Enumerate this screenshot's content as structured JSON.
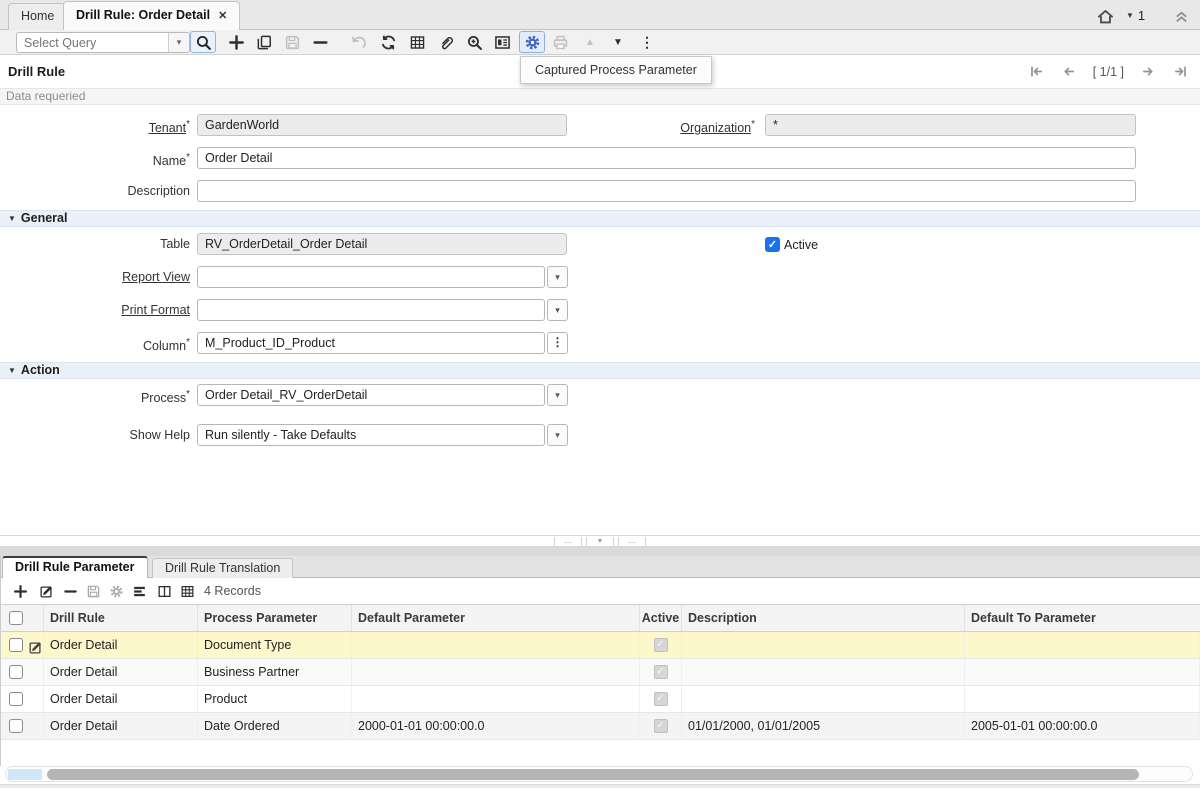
{
  "window": {
    "tabs": [
      {
        "label": "Home"
      },
      {
        "label": "Drill Rule: Order Detail"
      }
    ],
    "session_count": "1"
  },
  "icons": {
    "close": "✕",
    "chevron_down": "▾",
    "section_caret": "▼",
    "up_triangle": "▲",
    "down_triangle": "▼",
    "overflow": "⋮",
    "check": "✓",
    "ellipsis": "…"
  },
  "toolbar": {
    "select_query_placeholder": "Select Query",
    "tooltip": "Captured Process Parameter"
  },
  "header": {
    "title": "Drill Rule",
    "status": "Data requeried",
    "page_indicator": "[ 1/1 ]"
  },
  "form": {
    "required_marker": "*",
    "tenant": {
      "label": "Tenant",
      "value": "GardenWorld"
    },
    "organization": {
      "label": "Organization",
      "value": "*"
    },
    "name": {
      "label": "Name",
      "value": "Order Detail"
    },
    "description": {
      "label": "Description",
      "value": ""
    },
    "general_section": "General",
    "table": {
      "label": "Table",
      "value": "RV_OrderDetail_Order Detail"
    },
    "active": {
      "label": "Active",
      "checked": true
    },
    "report_view": {
      "label": "Report View",
      "value": ""
    },
    "print_format": {
      "label": "Print Format",
      "value": ""
    },
    "column": {
      "label": "Column",
      "value": "M_Product_ID_Product"
    },
    "action_section": "Action",
    "process": {
      "label": "Process",
      "value": "Order Detail_RV_OrderDetail"
    },
    "show_help": {
      "label": "Show Help",
      "value": "Run silently - Take Defaults"
    }
  },
  "detail": {
    "tabs": [
      {
        "label": "Drill Rule Parameter"
      },
      {
        "label": "Drill Rule Translation"
      }
    ],
    "records_label": "4 Records",
    "grid": {
      "columns": [
        "Drill Rule",
        "Process Parameter",
        "Default Parameter",
        "Active",
        "Description",
        "Default To Parameter"
      ],
      "rows": [
        {
          "drill_rule": "Order Detail",
          "process_parameter": "Document Type",
          "default_parameter": "",
          "active": true,
          "description": "",
          "default_to_parameter": ""
        },
        {
          "drill_rule": "Order Detail",
          "process_parameter": "Business Partner",
          "default_parameter": "",
          "active": true,
          "description": "",
          "default_to_parameter": ""
        },
        {
          "drill_rule": "Order Detail",
          "process_parameter": "Product",
          "default_parameter": "",
          "active": true,
          "description": "",
          "default_to_parameter": ""
        },
        {
          "drill_rule": "Order Detail",
          "process_parameter": "Date Ordered",
          "default_parameter": "2000-01-01 00:00:00.0",
          "active": true,
          "description": "01/01/2000, 01/01/2005",
          "default_to_parameter": "2005-01-01 00:00:00.0"
        }
      ]
    }
  }
}
